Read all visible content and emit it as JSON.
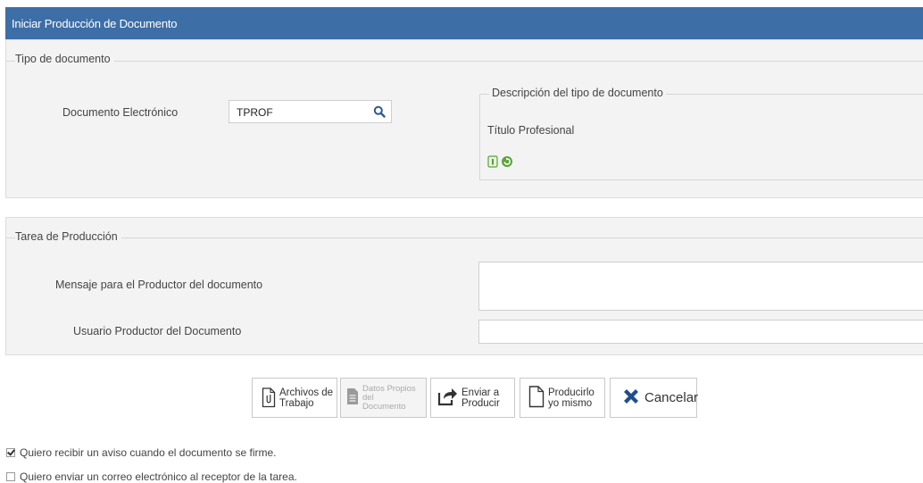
{
  "window": {
    "title": "Iniciar Producción de Documento"
  },
  "tipo_documento": {
    "legend": "Tipo de documento",
    "field_label": "Documento Electrónico",
    "field_value": "TPROF",
    "description": {
      "legend": "Descripción del tipo de documento",
      "value": "Título Profesional"
    }
  },
  "tarea": {
    "legend": "Tarea de Producción",
    "mensaje_label": "Mensaje para el Productor del documento",
    "mensaje_value": "",
    "usuario_label": "Usuario Productor del Documento",
    "usuario_value": ""
  },
  "buttons": {
    "archivos_line1": "Archivos de",
    "archivos_line2": "Trabajo",
    "datos_line1": "Datos Propios del",
    "datos_line2": "Documento",
    "enviar_line1": "Enviar a",
    "enviar_line2": "Producir",
    "producir_line1": "Producirlo",
    "producir_line2": "yo mismo",
    "cancelar": "Cancelar"
  },
  "checkboxes": [
    {
      "label": "Quiero recibir un aviso cuando el documento se firme.",
      "checked": true
    },
    {
      "label": "Quiero enviar un correo electrónico al receptor de la tarea.",
      "checked": false
    }
  ],
  "colors": {
    "header": "#3d6ea6",
    "panel": "#f3f3f3",
    "cancel_icon": "#1f4e8c",
    "green_icon": "#5aa53a"
  }
}
